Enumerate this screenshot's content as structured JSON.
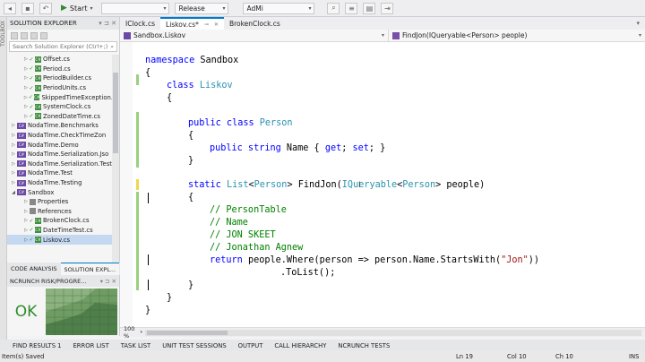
{
  "toolbar": {
    "start_label": "Start",
    "config": "Release",
    "platform": "AdMi"
  },
  "left_rail": {
    "label": "TOOLBOX"
  },
  "solution_explorer": {
    "title": "SOLUTION EXPLORER",
    "search_placeholder": "Search Solution Explorer (Ctrl+;)",
    "items": [
      {
        "label": "Offset.cs",
        "kind": "file",
        "selected": false
      },
      {
        "label": "Period.cs",
        "kind": "file",
        "selected": false
      },
      {
        "label": "PeriodBuilder.cs",
        "kind": "file",
        "selected": false
      },
      {
        "label": "PeriodUnits.cs",
        "kind": "file",
        "selected": false
      },
      {
        "label": "SkippedTimeException.",
        "kind": "file",
        "selected": false
      },
      {
        "label": "SystemClock.cs",
        "kind": "file",
        "selected": false
      },
      {
        "label": "ZonedDateTime.cs",
        "kind": "file",
        "selected": false
      },
      {
        "label": "NodaTime.Benchmarks",
        "kind": "project",
        "selected": false
      },
      {
        "label": "NodaTime.CheckTimeZon",
        "kind": "project",
        "selected": false
      },
      {
        "label": "NodaTime.Demo",
        "kind": "project",
        "selected": false
      },
      {
        "label": "NodaTime.Serialization.Jso",
        "kind": "project",
        "selected": false
      },
      {
        "label": "NodaTime.Serialization.Test",
        "kind": "project",
        "selected": false
      },
      {
        "label": "NodaTime.Test",
        "kind": "project",
        "selected": false
      },
      {
        "label": "NodaTime.Testing",
        "kind": "project",
        "selected": false
      },
      {
        "label": "Sandbox",
        "kind": "project-open",
        "selected": false
      },
      {
        "label": "Properties",
        "kind": "folder",
        "selected": false
      },
      {
        "label": "References",
        "kind": "folder",
        "selected": false
      },
      {
        "label": "BrokenClock.cs",
        "kind": "file",
        "selected": false
      },
      {
        "label": "DateTimeTest.cs",
        "kind": "file",
        "selected": false
      },
      {
        "label": "Liskov.cs",
        "kind": "file",
        "selected": true
      }
    ]
  },
  "panel_tabs": [
    {
      "label": "CODE ANALYSIS",
      "active": false
    },
    {
      "label": "SOLUTION EXPL...",
      "active": true
    }
  ],
  "ncrunch": {
    "title": "NCRUNCH RISK/PROGRE...",
    "status": "OK"
  },
  "doc_tabs": [
    {
      "label": "IClock.cs",
      "active": false
    },
    {
      "label": "Liskov.cs*",
      "active": true
    },
    {
      "label": "BrokenClock.cs",
      "active": false
    }
  ],
  "nav_bar": {
    "class_path": "Sandbox.Liskov",
    "member": "FindJon(IQueryable<Person> people)"
  },
  "code": {
    "l1": "namespace",
    "l1b": "Sandbox",
    "l2": "{",
    "l3a": "class",
    "l3b": "Liskov",
    "l4": "{",
    "l6a": "public class",
    "l6b": "Person",
    "l7": "{",
    "l8a": "public string",
    "l8b": "Name { ",
    "l8c": "get",
    "l8d": "; ",
    "l8e": "set",
    "l8f": "; }",
    "l9": "}",
    "l11a": "static",
    "l11b": "List",
    "l11c": "<",
    "l11d": "Person",
    "l11e": "> FindJon(",
    "l11f": "IQueryable",
    "l11g": "<",
    "l11h": "Person",
    "l11i": "> people)",
    "l12": "{",
    "l13": "// PersonTable",
    "l14": "// Name",
    "l15": "// JON SKEET",
    "l16": "// Jonathan Agnew",
    "l17a": "return",
    "l17b": "people.Where(person => person.Name.StartsWith(",
    "l17c": "\"Jon\"",
    "l17d": "))",
    "l18": ".ToList();",
    "l19": "}",
    "l20": "}",
    "l21": "}"
  },
  "zoom": "100 %",
  "bottom_tabs": [
    "FIND RESULTS 1",
    "ERROR LIST",
    "TASK LIST",
    "UNIT TEST SESSIONS",
    "OUTPUT",
    "CALL HIERARCHY",
    "NCRUNCH TESTS"
  ],
  "status": {
    "message": "Item(s) Saved",
    "line": "Ln 19",
    "col": "Col 10",
    "ch": "Ch 10",
    "mode": "INS"
  }
}
